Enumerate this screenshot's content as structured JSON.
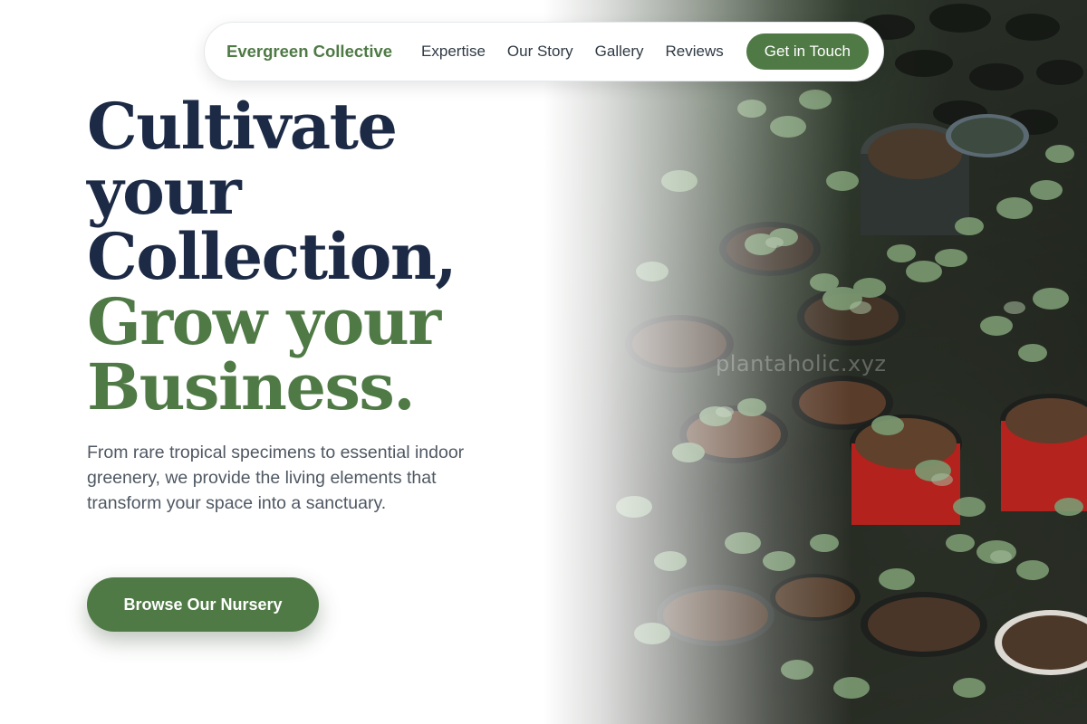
{
  "nav": {
    "brand": "Evergreen Collective",
    "links": [
      "Expertise",
      "Our Story",
      "Gallery",
      "Reviews"
    ],
    "cta": "Get in Touch"
  },
  "hero": {
    "headline_dark": [
      "Cultivate",
      "your",
      "Collection,"
    ],
    "headline_green": [
      "Grow your",
      "Business."
    ],
    "subtext": "From rare tropical specimens to essential indoor greenery, we provide the living elements that transform your space into a sanctuary.",
    "button": "Browse Our Nursery"
  },
  "image": {
    "subject": "potted plants in nursery trays",
    "watermark": "plantaholic.xyz"
  },
  "colors": {
    "brand_green": "#4f7a45",
    "headline_navy": "#1c2a45",
    "body_text": "#4f5863",
    "nav_text": "#2f3a44"
  }
}
